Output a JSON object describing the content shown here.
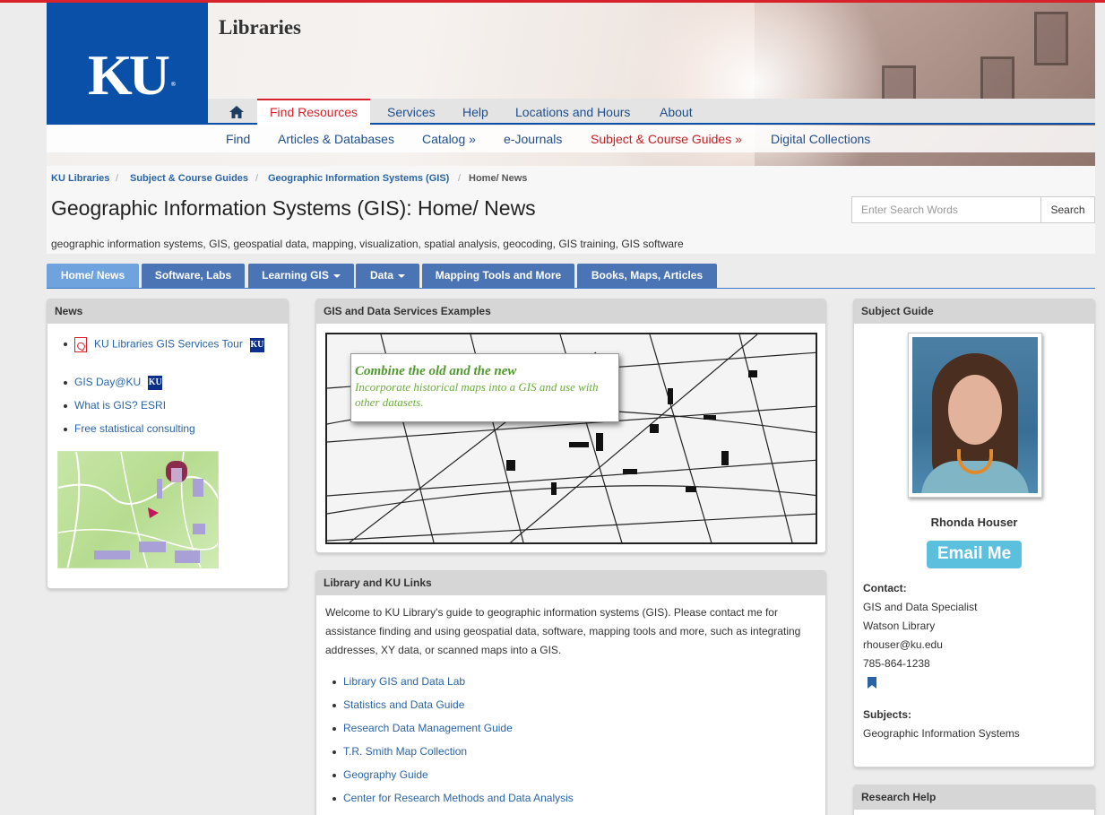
{
  "header": {
    "logo_text": "KU",
    "library_title": "Libraries"
  },
  "nav_primary": {
    "home_icon": "home-icon",
    "items": [
      "Find Resources",
      "Services",
      "Help",
      "Locations and Hours",
      "About"
    ]
  },
  "nav_secondary": {
    "items": [
      "Find",
      "Articles & Databases",
      "Catalog »",
      "e-Journals",
      "Subject & Course Guides »",
      "Digital Collections"
    ]
  },
  "breadcrumb": [
    "KU Libraries",
    "Subject & Course Guides",
    "Geographic Information Systems (GIS)",
    "Home/ News"
  ],
  "page": {
    "title": "Geographic Information Systems (GIS): Home/ News",
    "keywords": "geographic information systems, GIS, geospatial data, mapping, visualization, spatial analysis, geocoding, GIS training, GIS software"
  },
  "search": {
    "placeholder": "Enter Search Words",
    "button": "Search"
  },
  "tabs": [
    "Home/ News",
    "Software, Labs",
    "Learning GIS",
    "Data",
    "Mapping Tools and More",
    "Books, Maps, Articles"
  ],
  "news": {
    "heading": "News",
    "items": [
      "KU Libraries GIS Services Tour",
      "GIS Day@KU",
      "What is GIS? ESRI",
      "Free statistical consulting"
    ],
    "badge": "KU"
  },
  "examples": {
    "heading": "GIS and Data Services Examples",
    "overlay_title": "Combine the old and the new",
    "overlay_text": "Incorporate historical maps into a GIS and use with other datasets."
  },
  "links": {
    "heading": "Library and KU Links",
    "intro": "Welcome to KU Library's guide to geographic information systems (GIS). Please contact me for assistance finding and using geospatial data, software, mapping tools and more, such as integrating addresses, XY data, or scanned maps into a GIS.",
    "items": [
      "Library GIS and Data Lab",
      "Statistics and Data Guide",
      "Research Data Management Guide",
      "T.R. Smith Map Collection",
      "Geography Guide",
      "Center for Research Methods and Data Analysis"
    ]
  },
  "subject_guide": {
    "heading": "Subject Guide",
    "name": "Rhonda Houser",
    "email_button": "Email Me",
    "contact_label": "Contact:",
    "contact_lines": [
      "GIS and Data Specialist",
      "Watson Library",
      "rhouser@ku.edu",
      "785-864-1238"
    ],
    "subjects_label": "Subjects:",
    "subject_link": "Geographic Information Systems"
  },
  "research_help": {
    "heading": "Research Help"
  }
}
